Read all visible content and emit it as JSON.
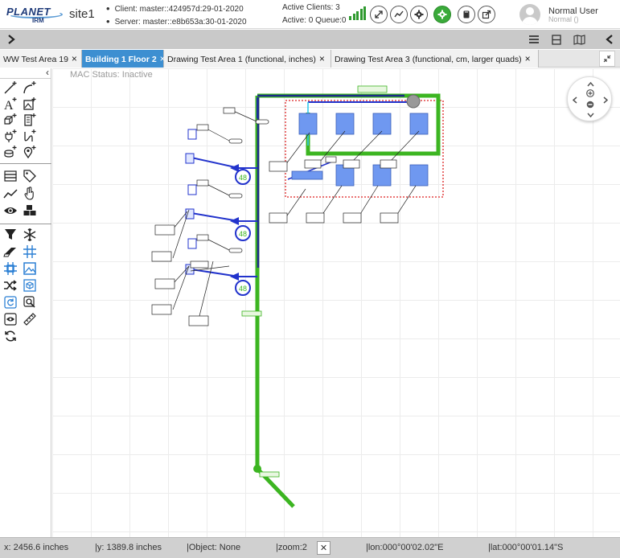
{
  "header": {
    "logo_text": "PLANET",
    "logo_subtext": "IRM",
    "site": "site1",
    "client": "Client: master::424957d:29-01-2020",
    "server": "Server: master::e8b653a:30-01-2020",
    "active_clients": "Active Clients: 3",
    "active_queue": "Active: 0 Queue:0",
    "signal_bars": [
      5,
      8,
      11,
      14,
      17
    ],
    "buttons": [
      "fullscreen-icon",
      "chart-icon",
      "gear-icon",
      "settings-green-icon",
      "book-icon",
      "external-link-icon"
    ],
    "user_name": "Normal User",
    "user_role": "Normal ()"
  },
  "toolbar": {
    "left_icon": "chevron-right-icon",
    "right_icons": [
      "hamburger-icon",
      "layout-icon",
      "map-icon",
      "chevron-left-icon"
    ]
  },
  "tabs": [
    {
      "label": "WW Test Area 19",
      "active": false
    },
    {
      "label": "Building 1 Floor 2",
      "active": true
    },
    {
      "label": "Drawing Test Area 1 (functional, inches)",
      "active": false
    },
    {
      "label": "Drawing Test Area 3 (functional, cm, larger quads)",
      "active": false
    }
  ],
  "tab_close_glyph": "×",
  "canvas": {
    "mac_status": "MAC Status: Inactive",
    "badge_label": "48"
  },
  "palette": {
    "tools": [
      "draw-line-icon",
      "draw-arc-icon",
      "add-text-icon",
      "add-image-icon",
      "add-shape-icon",
      "add-device-icon",
      "add-plug-icon",
      "add-cable-icon",
      "add-cylinder-icon",
      "add-location-icon",
      "layers-icon",
      "tag-icon",
      "trend-icon",
      "hand-icon",
      "eye-icon",
      "cubes-icon",
      "filter-icon",
      "snowflake-icon",
      "eraser-icon",
      "grid-icon",
      "grid-snap-icon",
      "image-frame-icon",
      "shuffle-icon",
      "cube-view-icon",
      "refresh-box-icon",
      "zoom-box-icon",
      "eye-box-icon",
      "ruler-icon",
      "rotate-icon"
    ]
  },
  "status": {
    "x": "x: 2456.6 inches",
    "y": "|y: 1389.8 inches",
    "object": "|Object: None",
    "zoom": "|zoom:2",
    "zoom_box": "✕",
    "lon": "|lon:000°00'02.02\"E",
    "lat": "|lat:000°00'01.14\"S"
  },
  "colors": {
    "tab_active": "#3d8fd1",
    "toolbar": "#c9c9c9",
    "statusbar": "#d0d0d0",
    "green_path": "#3cb521",
    "blue_path": "#2233cc",
    "device_fill": "#6f98f0",
    "dashed_red": "#dd2222"
  }
}
